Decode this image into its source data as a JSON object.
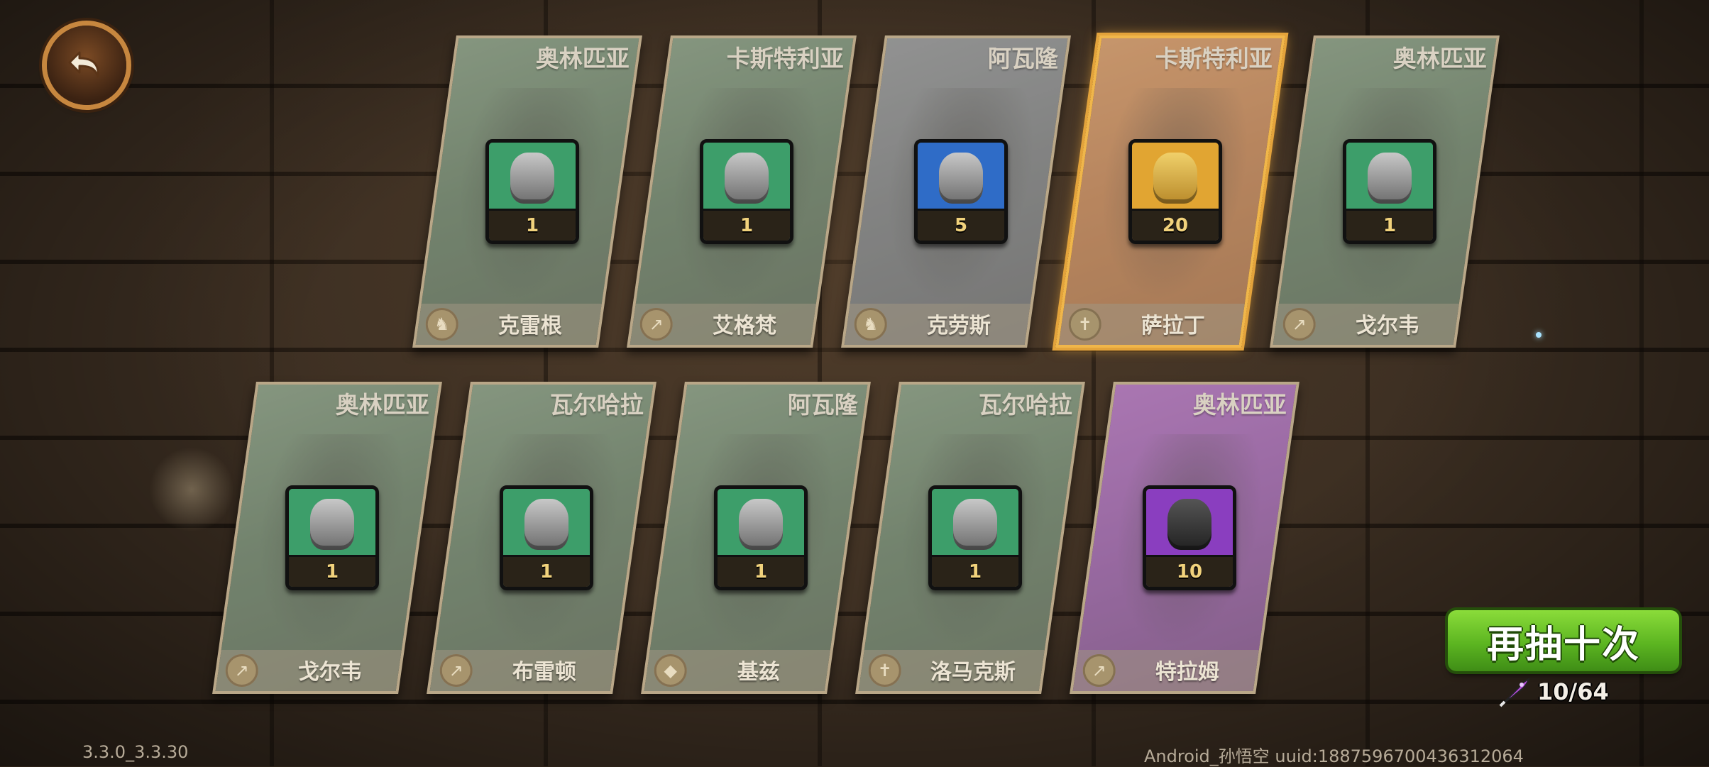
{
  "header": {
    "back_icon": "back-arrow-icon"
  },
  "cards_row1": [
    {
      "region": "奥林匹亚",
      "name": "克雷根",
      "count": "1",
      "color": "green",
      "class_icon": "horse-icon"
    },
    {
      "region": "卡斯特利亚",
      "name": "艾格梵",
      "count": "1",
      "color": "green",
      "class_icon": "spear-icon"
    },
    {
      "region": "阿瓦隆",
      "name": "克劳斯",
      "count": "5",
      "color": "blue",
      "class_icon": "horse-icon"
    },
    {
      "region": "卡斯特利亚",
      "name": "萨拉丁",
      "count": "20",
      "color": "orange",
      "class_icon": "sword-icon"
    },
    {
      "region": "奥林匹亚",
      "name": "戈尔韦",
      "count": "1",
      "color": "green",
      "class_icon": "spear-icon"
    }
  ],
  "cards_row2": [
    {
      "region": "奥林匹亚",
      "name": "戈尔韦",
      "count": "1",
      "color": "green",
      "class_icon": "spear-icon"
    },
    {
      "region": "瓦尔哈拉",
      "name": "布雷顿",
      "count": "1",
      "color": "green",
      "class_icon": "spear-icon"
    },
    {
      "region": "阿瓦隆",
      "name": "基兹",
      "count": "1",
      "color": "green",
      "class_icon": "shield-icon"
    },
    {
      "region": "瓦尔哈拉",
      "name": "洛马克斯",
      "count": "1",
      "color": "green",
      "class_icon": "sword-icon"
    },
    {
      "region": "奥林匹亚",
      "name": "特拉姆",
      "count": "10",
      "color": "purple",
      "class_icon": "spear-icon"
    }
  ],
  "actions": {
    "retry_label": "再抽十次",
    "cost_text": "10/64",
    "cost_icon": "rocket-icon"
  },
  "footer": {
    "version": "3.3.0_3.3.30",
    "user_info": "Android_孙悟空 uuid:1887596700436312064"
  }
}
